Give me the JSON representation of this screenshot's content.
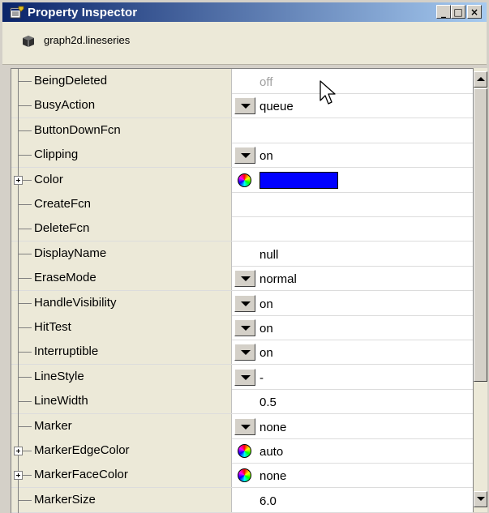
{
  "window": {
    "title": "Property Inspector",
    "buttons": {
      "minimize": "_",
      "maximize": "□",
      "close": "×"
    }
  },
  "header": {
    "object_label": "graph2d.lineseries"
  },
  "properties": [
    {
      "name": "BeingDeleted",
      "value": "off",
      "editor": "none",
      "greyed": true,
      "expandable": false
    },
    {
      "name": "BusyAction",
      "value": "queue",
      "editor": "dropdown",
      "expandable": false
    },
    {
      "name": "ButtonDownFcn",
      "value": "",
      "editor": "none",
      "expandable": false
    },
    {
      "name": "Clipping",
      "value": "on",
      "editor": "dropdown",
      "expandable": false
    },
    {
      "name": "Color",
      "value": "",
      "editor": "color",
      "swatch": "#0000ff",
      "expandable": true
    },
    {
      "name": "CreateFcn",
      "value": "",
      "editor": "none",
      "expandable": false
    },
    {
      "name": "DeleteFcn",
      "value": "",
      "editor": "none",
      "expandable": false
    },
    {
      "name": "DisplayName",
      "value": "null",
      "editor": "none",
      "expandable": false
    },
    {
      "name": "EraseMode",
      "value": "normal",
      "editor": "dropdown",
      "expandable": false
    },
    {
      "name": "HandleVisibility",
      "value": "on",
      "editor": "dropdown",
      "expandable": false
    },
    {
      "name": "HitTest",
      "value": "on",
      "editor": "dropdown",
      "expandable": false
    },
    {
      "name": "Interruptible",
      "value": "on",
      "editor": "dropdown",
      "expandable": false
    },
    {
      "name": "LineStyle",
      "value": "-",
      "editor": "dropdown",
      "expandable": false
    },
    {
      "name": "LineWidth",
      "value": "0.5",
      "editor": "none",
      "expandable": false
    },
    {
      "name": "Marker",
      "value": "none",
      "editor": "dropdown",
      "expandable": false
    },
    {
      "name": "MarkerEdgeColor",
      "value": "auto",
      "editor": "color",
      "expandable": true
    },
    {
      "name": "MarkerFaceColor",
      "value": "none",
      "editor": "color",
      "expandable": true
    },
    {
      "name": "MarkerSize",
      "value": "6.0",
      "editor": "none",
      "expandable": false
    }
  ],
  "colors": {
    "titlebar_start": "#0a246a",
    "titlebar_end": "#a6caf0",
    "name_column": "#ece9d8",
    "value_column": "#ffffff"
  }
}
